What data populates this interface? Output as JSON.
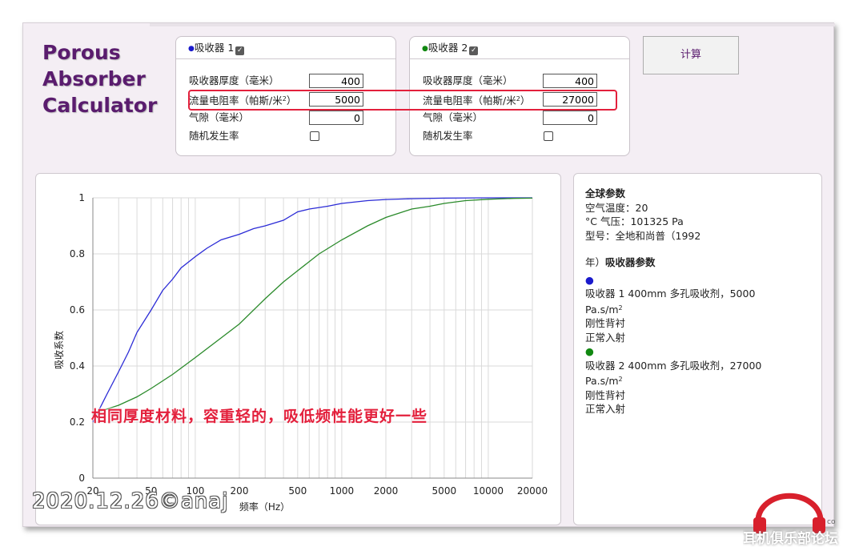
{
  "app": {
    "logo_lines": [
      "Porous",
      "Absorber",
      "Calculator"
    ],
    "calc_button": "计算"
  },
  "absorbers": [
    {
      "title": "吸收器 1",
      "dot_color": "#1a1acc",
      "enabled": true,
      "thickness_label": "吸收器厚度（毫米）",
      "thickness": "400",
      "flow_label": "流量电阻率（帕斯/米",
      "flow_sup": "2",
      "flow_close": "）",
      "flow": "5000",
      "gap_label": "气隙（毫米）",
      "gap": "0",
      "random_label": "随机发生率"
    },
    {
      "title": "吸收器 2",
      "dot_color": "#118811",
      "enabled": true,
      "thickness_label": "吸收器厚度（毫米）",
      "thickness": "400",
      "flow_label": "流量电阻率（帕斯/米",
      "flow_sup": "2",
      "flow_close": "）",
      "flow": "27000",
      "gap_label": "气隙（毫米）",
      "gap": "0",
      "random_label": "随机发生率"
    }
  ],
  "info": {
    "global_title": "全球参数",
    "air_temp": "空气温度：20",
    "pressure": "°C 气压：101325 Pa",
    "model": "型号：全地和尚普（1992",
    "absorber_title_prefix": "年）",
    "absorber_title": "吸收器参数",
    "a1_dot": "●",
    "a1_line1": "吸收器 1 400mm 多孔吸收剂，5000",
    "a1_unit": "Pa.s/m",
    "a1_unit_sup": "2",
    "a1_backing": "刚性背衬",
    "a1_incidence": "正常入射",
    "a2_dot": "●",
    "a2_line1": "吸收器 2 400mm 多孔吸收剂，27000",
    "a2_unit": "Pa.s/m",
    "a2_unit_sup": "2",
    "a2_backing": "刚性背衬",
    "a2_incidence": "正常入射"
  },
  "annotation": "相同厚度材料，容重轻的，吸低频性能更好一些",
  "watermark": "2020.12.26©anaj",
  "forum_logo_text": "耳机俱乐部论坛",
  "chart_data": {
    "type": "line",
    "xscale": "log",
    "xlim": [
      20,
      20000
    ],
    "ylim": [
      0,
      1
    ],
    "xlabel": "频率（Hz）",
    "ylabel": "吸收系数",
    "x_ticks": [
      20,
      50,
      100,
      200,
      500,
      1000,
      2000,
      5000,
      10000,
      20000
    ],
    "y_ticks": [
      0,
      0.2,
      0.4,
      0.6,
      0.8,
      1
    ],
    "series": [
      {
        "color": "#2b2bd6",
        "x": [
          20,
          25,
          30,
          35,
          40,
          50,
          60,
          70,
          80,
          100,
          120,
          150,
          200,
          250,
          300,
          400,
          500,
          600,
          800,
          1000,
          1500,
          2000,
          3000,
          5000,
          10000,
          20000
        ],
        "y": [
          0.2,
          0.3,
          0.38,
          0.45,
          0.52,
          0.6,
          0.67,
          0.71,
          0.75,
          0.79,
          0.82,
          0.85,
          0.87,
          0.89,
          0.9,
          0.92,
          0.95,
          0.96,
          0.97,
          0.98,
          0.99,
          0.994,
          0.997,
          0.999,
          1.0,
          1.0
        ]
      },
      {
        "color": "#2a8a2a",
        "x": [
          20,
          30,
          40,
          50,
          70,
          100,
          150,
          200,
          300,
          400,
          500,
          700,
          1000,
          1500,
          2000,
          3000,
          4000,
          5000,
          7000,
          10000,
          15000,
          20000
        ],
        "y": [
          0.23,
          0.26,
          0.29,
          0.32,
          0.37,
          0.43,
          0.5,
          0.55,
          0.64,
          0.7,
          0.74,
          0.8,
          0.85,
          0.9,
          0.93,
          0.96,
          0.97,
          0.98,
          0.99,
          0.995,
          0.998,
          0.999
        ]
      }
    ]
  }
}
